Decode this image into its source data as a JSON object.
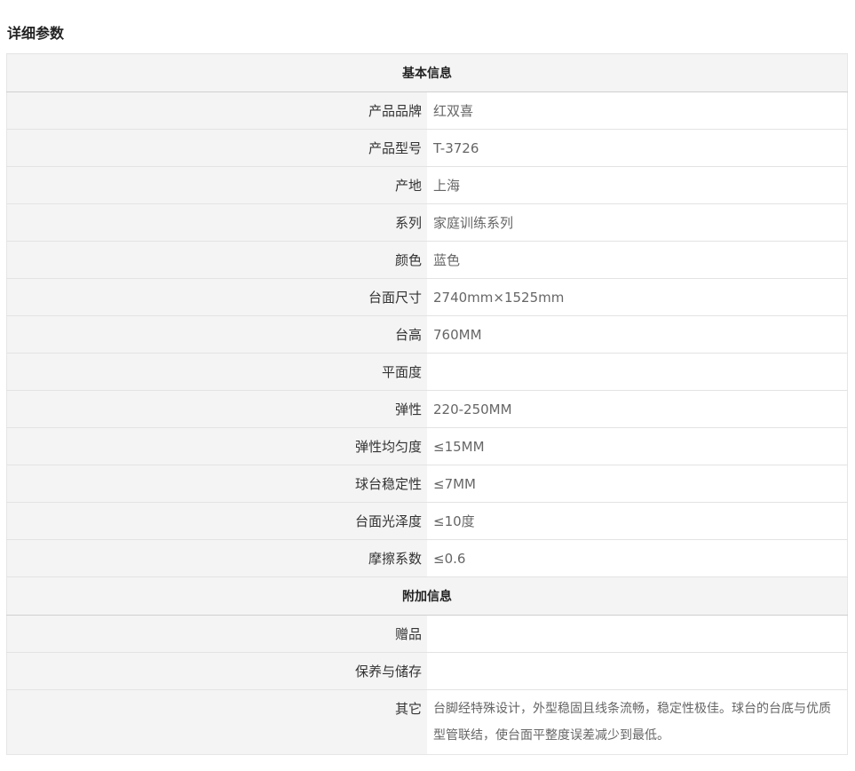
{
  "heading": "详细参数",
  "sections": [
    {
      "title": "基本信息",
      "rows": [
        {
          "label": "产品品牌",
          "value": "红双喜"
        },
        {
          "label": "产品型号",
          "value": "T-3726"
        },
        {
          "label": "产地",
          "value": "上海"
        },
        {
          "label": "系列",
          "value": "家庭训练系列"
        },
        {
          "label": "颜色",
          "value": "蓝色"
        },
        {
          "label": "台面尺寸",
          "value": "2740mm×1525mm"
        },
        {
          "label": "台高",
          "value": "760MM"
        },
        {
          "label": "平面度",
          "value": ""
        },
        {
          "label": "弹性",
          "value": "220-250MM"
        },
        {
          "label": "弹性均匀度",
          "value": "≤15MM"
        },
        {
          "label": "球台稳定性",
          "value": "≤7MM"
        },
        {
          "label": "台面光泽度",
          "value": "≤10度"
        },
        {
          "label": "摩擦系数",
          "value": "≤0.6"
        }
      ]
    },
    {
      "title": "附加信息",
      "rows": [
        {
          "label": "赠品",
          "value": ""
        },
        {
          "label": "保养与储存",
          "value": ""
        },
        {
          "label": "其它",
          "value": "台脚经特殊设计，外型稳固且线条流畅，稳定性极佳。球台的台底与优质型管联结，使台面平整度误差减少到最低。"
        }
      ]
    }
  ]
}
